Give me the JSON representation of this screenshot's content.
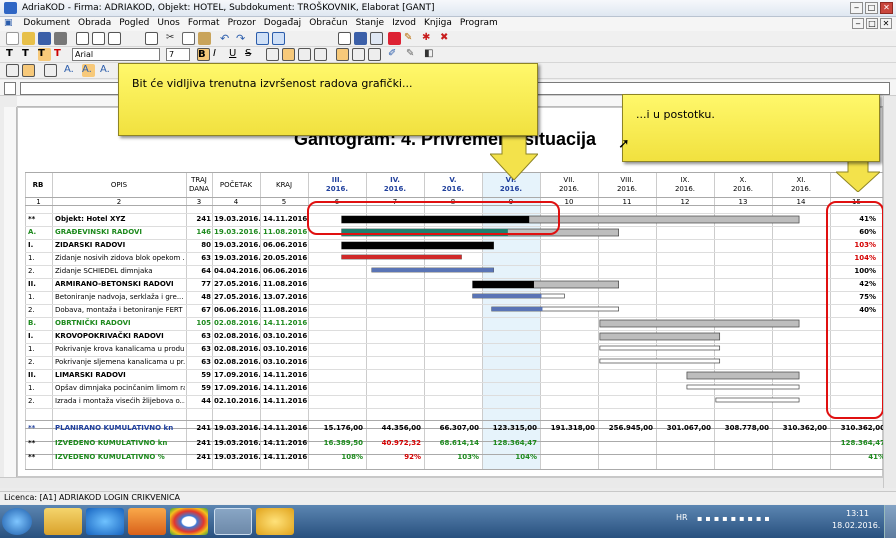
{
  "window": {
    "title": "AdriaKOD - Firma: ADRIAKOD, Objekt: HOTEL, Subdokument: TROŠKOVNIK, Elaborat [GANT]"
  },
  "menu": [
    "Dokument",
    "Obrada",
    "Pogled",
    "Unos",
    "Format",
    "Prozor",
    "Događaj",
    "Obračun",
    "Stanje",
    "Izvod",
    "Knjiga",
    "Program"
  ],
  "format": {
    "font": "Arial",
    "size": "7"
  },
  "gantt": {
    "title": "Gantogram: 4. Privremena situacija",
    "headers": {
      "rb": "RB",
      "opis": "OPIS",
      "trajanje": "TRAJ DANA",
      "pocetak": "POČETAK",
      "kraj": "KRAJ"
    },
    "colnums": [
      "1",
      "2",
      "3",
      "4",
      "5",
      "6",
      "7",
      "8",
      "9",
      "10",
      "11",
      "12",
      "13",
      "14",
      "15"
    ],
    "months": [
      [
        "III.",
        "2016."
      ],
      [
        "IV.",
        "2016."
      ],
      [
        "V.",
        "2016."
      ],
      [
        "VI.",
        "2016."
      ],
      [
        "VII.",
        "2016."
      ],
      [
        "VIII.",
        "2016."
      ],
      [
        "IX.",
        "2016."
      ],
      [
        "X.",
        "2016."
      ],
      [
        "XI.",
        "2016."
      ],
      [
        "",
        "2016."
      ]
    ],
    "rows": [
      {
        "rb": "**",
        "opis": "Objekt: Hotel XYZ",
        "traj": "241",
        "poc": "19.03.2016.",
        "kraj": "14.11.2016.",
        "pct": "41%",
        "style": "b"
      },
      {
        "rb": "A.",
        "opis": "GRAĐEVINSKI RADOVI",
        "traj": "146",
        "poc": "19.03.2016.",
        "kraj": "11.08.2016.",
        "pct": "60%",
        "style": "g"
      },
      {
        "rb": "I.",
        "opis": "ZIDARSKI RADOVI",
        "traj": "80",
        "poc": "19.03.2016.",
        "kraj": "06.06.2016.",
        "pct": "103%",
        "style": "b"
      },
      {
        "rb": "1.",
        "opis": "Zidanje nosivih zidova blok opekom ...",
        "traj": "63",
        "poc": "19.03.2016.",
        "kraj": "20.05.2016.",
        "pct": "104%",
        "style": ""
      },
      {
        "rb": "2.",
        "opis": "Zidanje SCHIEDEL dimnjaka",
        "traj": "64",
        "poc": "04.04.2016.",
        "kraj": "06.06.2016.",
        "pct": "100%",
        "style": ""
      },
      {
        "rb": "II.",
        "opis": "ARMIRANO-BETONSKI RADOVI",
        "traj": "77",
        "poc": "27.05.2016.",
        "kraj": "11.08.2016.",
        "pct": "42%",
        "style": "b"
      },
      {
        "rb": "1.",
        "opis": "Betoniranje nadvoja, serklaža i gre...",
        "traj": "48",
        "poc": "27.05.2016.",
        "kraj": "13.07.2016.",
        "pct": "75%",
        "style": ""
      },
      {
        "rb": "2.",
        "opis": "Dobava, montaža i betoniranje FERT ...",
        "traj": "67",
        "poc": "06.06.2016.",
        "kraj": "11.08.2016.",
        "pct": "40%",
        "style": ""
      },
      {
        "rb": "B.",
        "opis": "OBRTNIČKI RADOVI",
        "traj": "105",
        "poc": "02.08.2016.",
        "kraj": "14.11.2016.",
        "pct": "",
        "style": "g"
      },
      {
        "rb": "I.",
        "opis": "KROVOPOKRIVAČKI RADOVI",
        "traj": "63",
        "poc": "02.08.2016.",
        "kraj": "03.10.2016.",
        "pct": "",
        "style": "b"
      },
      {
        "rb": "1.",
        "opis": "Pokrivanje krova kanalicama u produ...",
        "traj": "63",
        "poc": "02.08.2016.",
        "kraj": "03.10.2016.",
        "pct": "",
        "style": ""
      },
      {
        "rb": "2.",
        "opis": "Pokrivanje sljemena kanalicama u pr...",
        "traj": "63",
        "poc": "02.08.2016.",
        "kraj": "03.10.2016.",
        "pct": "",
        "style": ""
      },
      {
        "rb": "II.",
        "opis": "LIMARSKI RADOVI",
        "traj": "59",
        "poc": "17.09.2016.",
        "kraj": "14.11.2016.",
        "pct": "",
        "style": "b"
      },
      {
        "rb": "1.",
        "opis": "Opšav dimnjaka pocinčanim limom raz...",
        "traj": "59",
        "poc": "17.09.2016.",
        "kraj": "14.11.2016.",
        "pct": "",
        "style": ""
      },
      {
        "rb": "2.",
        "opis": "Izrada i montaža visećih žlijebova o...",
        "traj": "44",
        "poc": "02.10.2016.",
        "kraj": "14.11.2016.",
        "pct": "",
        "style": ""
      }
    ],
    "summary": [
      {
        "rb": "**",
        "opis": "PLANIRANO KUMULATIVNO kn",
        "traj": "241",
        "poc": "19.03.2016.",
        "kraj": "14.11.2016.",
        "vals": [
          "15.176,00",
          "44.356,00",
          "66.307,00",
          "123.315,00",
          "191.318,00",
          "256.945,00",
          "301.067,00",
          "308.778,00",
          "310.362,00",
          "310.362,00"
        ]
      },
      {
        "rb": "**",
        "opis": "IZVEDENO KUMULATIVNO kn",
        "traj": "241",
        "poc": "19.03.2016.",
        "kraj": "14.11.2016.",
        "vals": [
          "16.389,50",
          "40.972,32",
          "68.614,14",
          "128.364,47",
          "",
          "",
          "",
          "",
          "",
          "128.364,47"
        ]
      },
      {
        "rb": "**",
        "opis": "IZVEDENO KUMULATIVNO %",
        "traj": "241",
        "poc": "19.03.2016.",
        "kraj": "14.11.2016.",
        "vals": [
          "108%",
          "92%",
          "103%",
          "104%",
          "",
          "",
          "",
          "",
          "",
          "41%"
        ]
      }
    ]
  },
  "progress": [
    {
      "row": 0,
      "done": 0.41
    },
    {
      "row": 1,
      "done": 0.6
    },
    {
      "row": 2,
      "done": 1.0
    },
    {
      "row": 3,
      "done": 1.0
    },
    {
      "row": 4,
      "done": 1.0
    },
    {
      "row": 5,
      "done": 0.42
    },
    {
      "row": 6,
      "done": 0.75
    },
    {
      "row": 7,
      "done": 0.4
    },
    {
      "row": 8,
      "done": 0
    },
    {
      "row": 9,
      "done": 0
    },
    {
      "row": 10,
      "done": 0
    },
    {
      "row": 11,
      "done": 0
    },
    {
      "row": 12,
      "done": 0
    },
    {
      "row": 13,
      "done": 0
    },
    {
      "row": 14,
      "done": 0
    }
  ],
  "callouts": {
    "left": "Bit će vidljiva trenutna izvršenost radova grafički...",
    "right": "...i u postotku."
  },
  "statusbar": "Licenca: [A1] ADRIAKOD LOGIN CRIKVENICA",
  "tray": {
    "lang": "HR",
    "time": "13:11",
    "date": "18.02.2016."
  },
  "colors": {
    "accent": "#1f3f9c",
    "green": "#1e8a1e",
    "red": "#d40000",
    "callout": "#fff35c",
    "highlight_red": "#e01010"
  }
}
